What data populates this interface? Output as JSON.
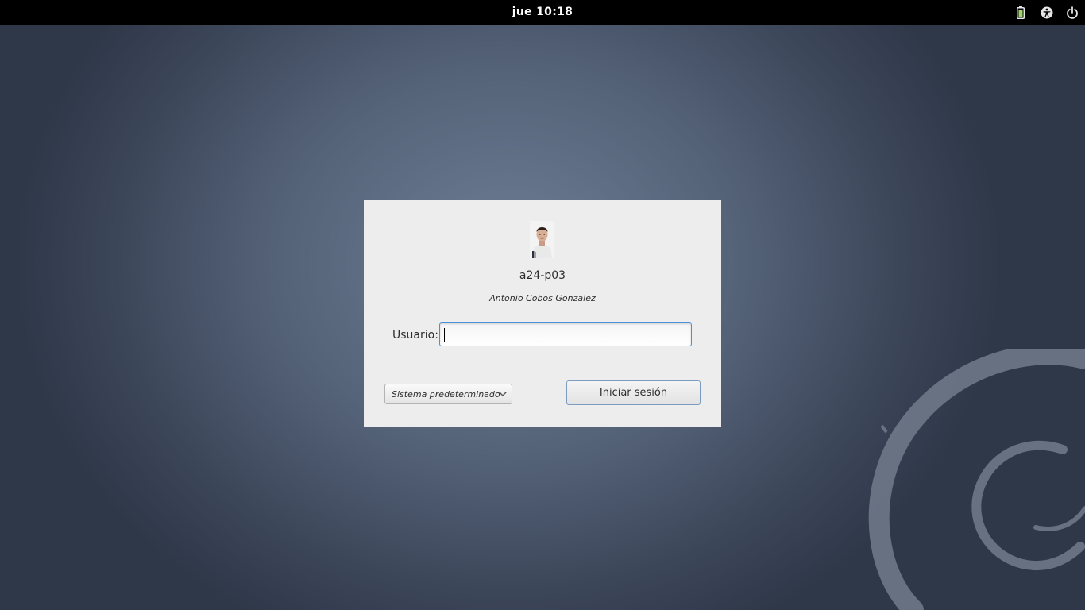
{
  "topbar": {
    "clock": "jue 10:18",
    "icons": [
      "battery-icon",
      "accessibility-icon",
      "power-icon"
    ]
  },
  "login": {
    "hostname": "a24-p03",
    "real_name": "Antonio Cobos Gonzalez",
    "user_label": "Usuario:",
    "user_value": "",
    "session_selected": "Sistema predeterminado",
    "login_button": "Iniciar sesión"
  },
  "colors": {
    "topbar": "#000000",
    "dialog": "#ededed",
    "focus_border": "#4a90d9",
    "background": "#56647a"
  }
}
